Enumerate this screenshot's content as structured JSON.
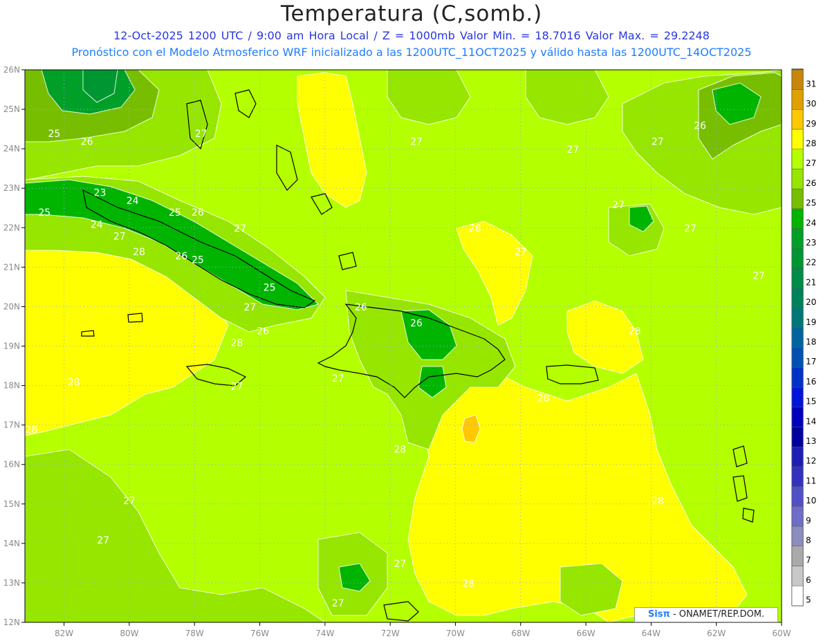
{
  "title": "Temperatura (C,somb.)",
  "subtitle1": "12-Oct-2025  1200 UTC / 9:00 am Hora Local / Z = 1000mb   Valor Min. = 18.7016  Valor Max. = 29.2248",
  "subtitle2": "Pronóstico con el Modelo Atmosferico WRF inicializado a las 1200UTC_11OCT2025 y válido hasta las  1200UTC_14OCT2025",
  "credit": {
    "brand": "Sisπ",
    "text": " - ONAMET/REP.DOM."
  },
  "chart_data": {
    "type": "heatmap",
    "title": "Temperatura (C,somb.)",
    "valor_min": 18.7016,
    "valor_max": 29.2248,
    "xlim": [
      -83.2,
      -60.0
    ],
    "ylim": [
      12,
      26
    ],
    "x_ticks": [
      "82W",
      "80W",
      "78W",
      "76W",
      "74W",
      "72W",
      "70W",
      "68W",
      "66W",
      "64W",
      "62W",
      "60W"
    ],
    "y_ticks": [
      "26N",
      "25N",
      "24N",
      "23N",
      "22N",
      "21N",
      "20N",
      "19N",
      "18N",
      "17N",
      "16N",
      "15N",
      "14N",
      "13N",
      "12N"
    ],
    "colorbar": {
      "levels": [
        31,
        30,
        29,
        28,
        27,
        26,
        25,
        24,
        23,
        22,
        21,
        20,
        19,
        18,
        17,
        16,
        15,
        14,
        13,
        12,
        11,
        10,
        9,
        8,
        7,
        6,
        5
      ],
      "colors": [
        "#c8860a",
        "#e0a000",
        "#ffc800",
        "#ffff00",
        "#b4ff00",
        "#96e600",
        "#78be00",
        "#00b400",
        "#00a028",
        "#009632",
        "#008c46",
        "#00825a",
        "#007878",
        "#0064a0",
        "#0050b4",
        "#0032c8",
        "#0014dc",
        "#0000be",
        "#0000a0",
        "#1e1eb4",
        "#3232be",
        "#5050c8",
        "#6e6ec8",
        "#8c8cbe",
        "#aaaaaa",
        "#c8c8c8",
        "#ffffff"
      ]
    },
    "contour_labels": [
      {
        "text": "25",
        "lon": -82.3,
        "lat": 24.3
      },
      {
        "text": "26",
        "lon": -81.3,
        "lat": 24.1
      },
      {
        "text": "27",
        "lon": -77.8,
        "lat": 24.3
      },
      {
        "text": "27",
        "lon": -71.2,
        "lat": 24.1
      },
      {
        "text": "27",
        "lon": -66.4,
        "lat": 23.9
      },
      {
        "text": "27",
        "lon": -63.8,
        "lat": 24.1
      },
      {
        "text": "26",
        "lon": -62.5,
        "lat": 24.5
      },
      {
        "text": "23",
        "lon": -80.9,
        "lat": 22.8
      },
      {
        "text": "24",
        "lon": -79.9,
        "lat": 22.6
      },
      {
        "text": "25",
        "lon": -82.6,
        "lat": 22.3
      },
      {
        "text": "24",
        "lon": -81.0,
        "lat": 22.0
      },
      {
        "text": "27",
        "lon": -80.3,
        "lat": 21.7
      },
      {
        "text": "25",
        "lon": -78.6,
        "lat": 22.3
      },
      {
        "text": "26",
        "lon": -77.9,
        "lat": 22.3
      },
      {
        "text": "27",
        "lon": -76.6,
        "lat": 21.9
      },
      {
        "text": "27",
        "lon": -65.0,
        "lat": 22.5
      },
      {
        "text": "27",
        "lon": -62.8,
        "lat": 21.9
      },
      {
        "text": "28",
        "lon": -79.7,
        "lat": 21.3
      },
      {
        "text": "26",
        "lon": -78.4,
        "lat": 21.2
      },
      {
        "text": "25",
        "lon": -77.9,
        "lat": 21.1
      },
      {
        "text": "28",
        "lon": -69.4,
        "lat": 21.9
      },
      {
        "text": "27",
        "lon": -68.0,
        "lat": 21.3
      },
      {
        "text": "27",
        "lon": -60.7,
        "lat": 20.7
      },
      {
        "text": "25",
        "lon": -75.7,
        "lat": 20.4
      },
      {
        "text": "27",
        "lon": -76.3,
        "lat": 19.9
      },
      {
        "text": "26",
        "lon": -72.9,
        "lat": 19.9
      },
      {
        "text": "26",
        "lon": -71.2,
        "lat": 19.5
      },
      {
        "text": "26",
        "lon": -75.9,
        "lat": 19.3
      },
      {
        "text": "28",
        "lon": -76.7,
        "lat": 19.0
      },
      {
        "text": "28",
        "lon": -64.5,
        "lat": 19.3
      },
      {
        "text": "28",
        "lon": -81.7,
        "lat": 18.0
      },
      {
        "text": "27",
        "lon": -76.7,
        "lat": 17.9
      },
      {
        "text": "27",
        "lon": -73.6,
        "lat": 18.1
      },
      {
        "text": "28",
        "lon": -67.3,
        "lat": 17.6
      },
      {
        "text": "28",
        "lon": -83.0,
        "lat": 16.8
      },
      {
        "text": "28",
        "lon": -71.7,
        "lat": 16.3
      },
      {
        "text": "27",
        "lon": -80.0,
        "lat": 15.0
      },
      {
        "text": "28",
        "lon": -63.8,
        "lat": 15.0
      },
      {
        "text": "27",
        "lon": -80.8,
        "lat": 14.0
      },
      {
        "text": "27",
        "lon": -71.7,
        "lat": 13.4
      },
      {
        "text": "28",
        "lon": -69.6,
        "lat": 12.9
      },
      {
        "text": "27",
        "lon": -73.6,
        "lat": 12.4
      }
    ]
  }
}
